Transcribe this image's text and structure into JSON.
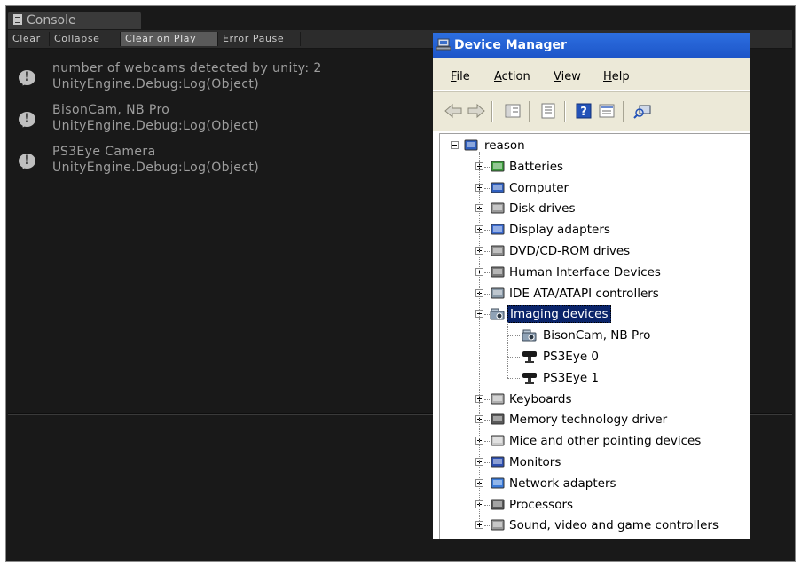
{
  "console": {
    "tab_label": "Console",
    "toolbar": [
      "Clear",
      "Collapse",
      "Clear on Play",
      "Error Pause"
    ],
    "logs": [
      {
        "line1": "number of webcams detected by unity: 2",
        "line2": "UnityEngine.Debug:Log(Object)"
      },
      {
        "line1": "BisonCam, NB Pro",
        "line2": "UnityEngine.Debug:Log(Object)"
      },
      {
        "line1": "PS3Eye Camera",
        "line2": "UnityEngine.Debug:Log(Object)"
      }
    ]
  },
  "device_manager": {
    "title": "Device Manager",
    "menu": [
      "File",
      "Action",
      "View",
      "Help"
    ],
    "root": "reason",
    "categories": [
      {
        "label": "Batteries",
        "icon": "battery-icon"
      },
      {
        "label": "Computer",
        "icon": "computer-icon"
      },
      {
        "label": "Disk drives",
        "icon": "disk-drive-icon"
      },
      {
        "label": "Display adapters",
        "icon": "display-adapter-icon"
      },
      {
        "label": "DVD/CD-ROM drives",
        "icon": "dvd-drive-icon"
      },
      {
        "label": "Human Interface Devices",
        "icon": "hid-icon"
      },
      {
        "label": "IDE ATA/ATAPI controllers",
        "icon": "ide-controller-icon"
      },
      {
        "label": "Imaging devices",
        "icon": "imaging-device-icon",
        "expanded": true,
        "selected": true
      },
      {
        "label": "Keyboards",
        "icon": "keyboard-icon"
      },
      {
        "label": "Memory technology driver",
        "icon": "memory-icon"
      },
      {
        "label": "Mice and other pointing devices",
        "icon": "mouse-icon"
      },
      {
        "label": "Monitors",
        "icon": "monitor-icon"
      },
      {
        "label": "Network adapters",
        "icon": "network-adapter-icon"
      },
      {
        "label": "Processors",
        "icon": "processor-icon"
      },
      {
        "label": "Sound, video and game controllers",
        "icon": "sound-icon"
      }
    ],
    "imaging_children": [
      {
        "label": "BisonCam, NB Pro",
        "icon": "webcam-icon"
      },
      {
        "label": "PS3Eye 0",
        "icon": "ps3eye-icon"
      },
      {
        "label": "PS3Eye 1",
        "icon": "ps3eye-icon"
      }
    ]
  }
}
